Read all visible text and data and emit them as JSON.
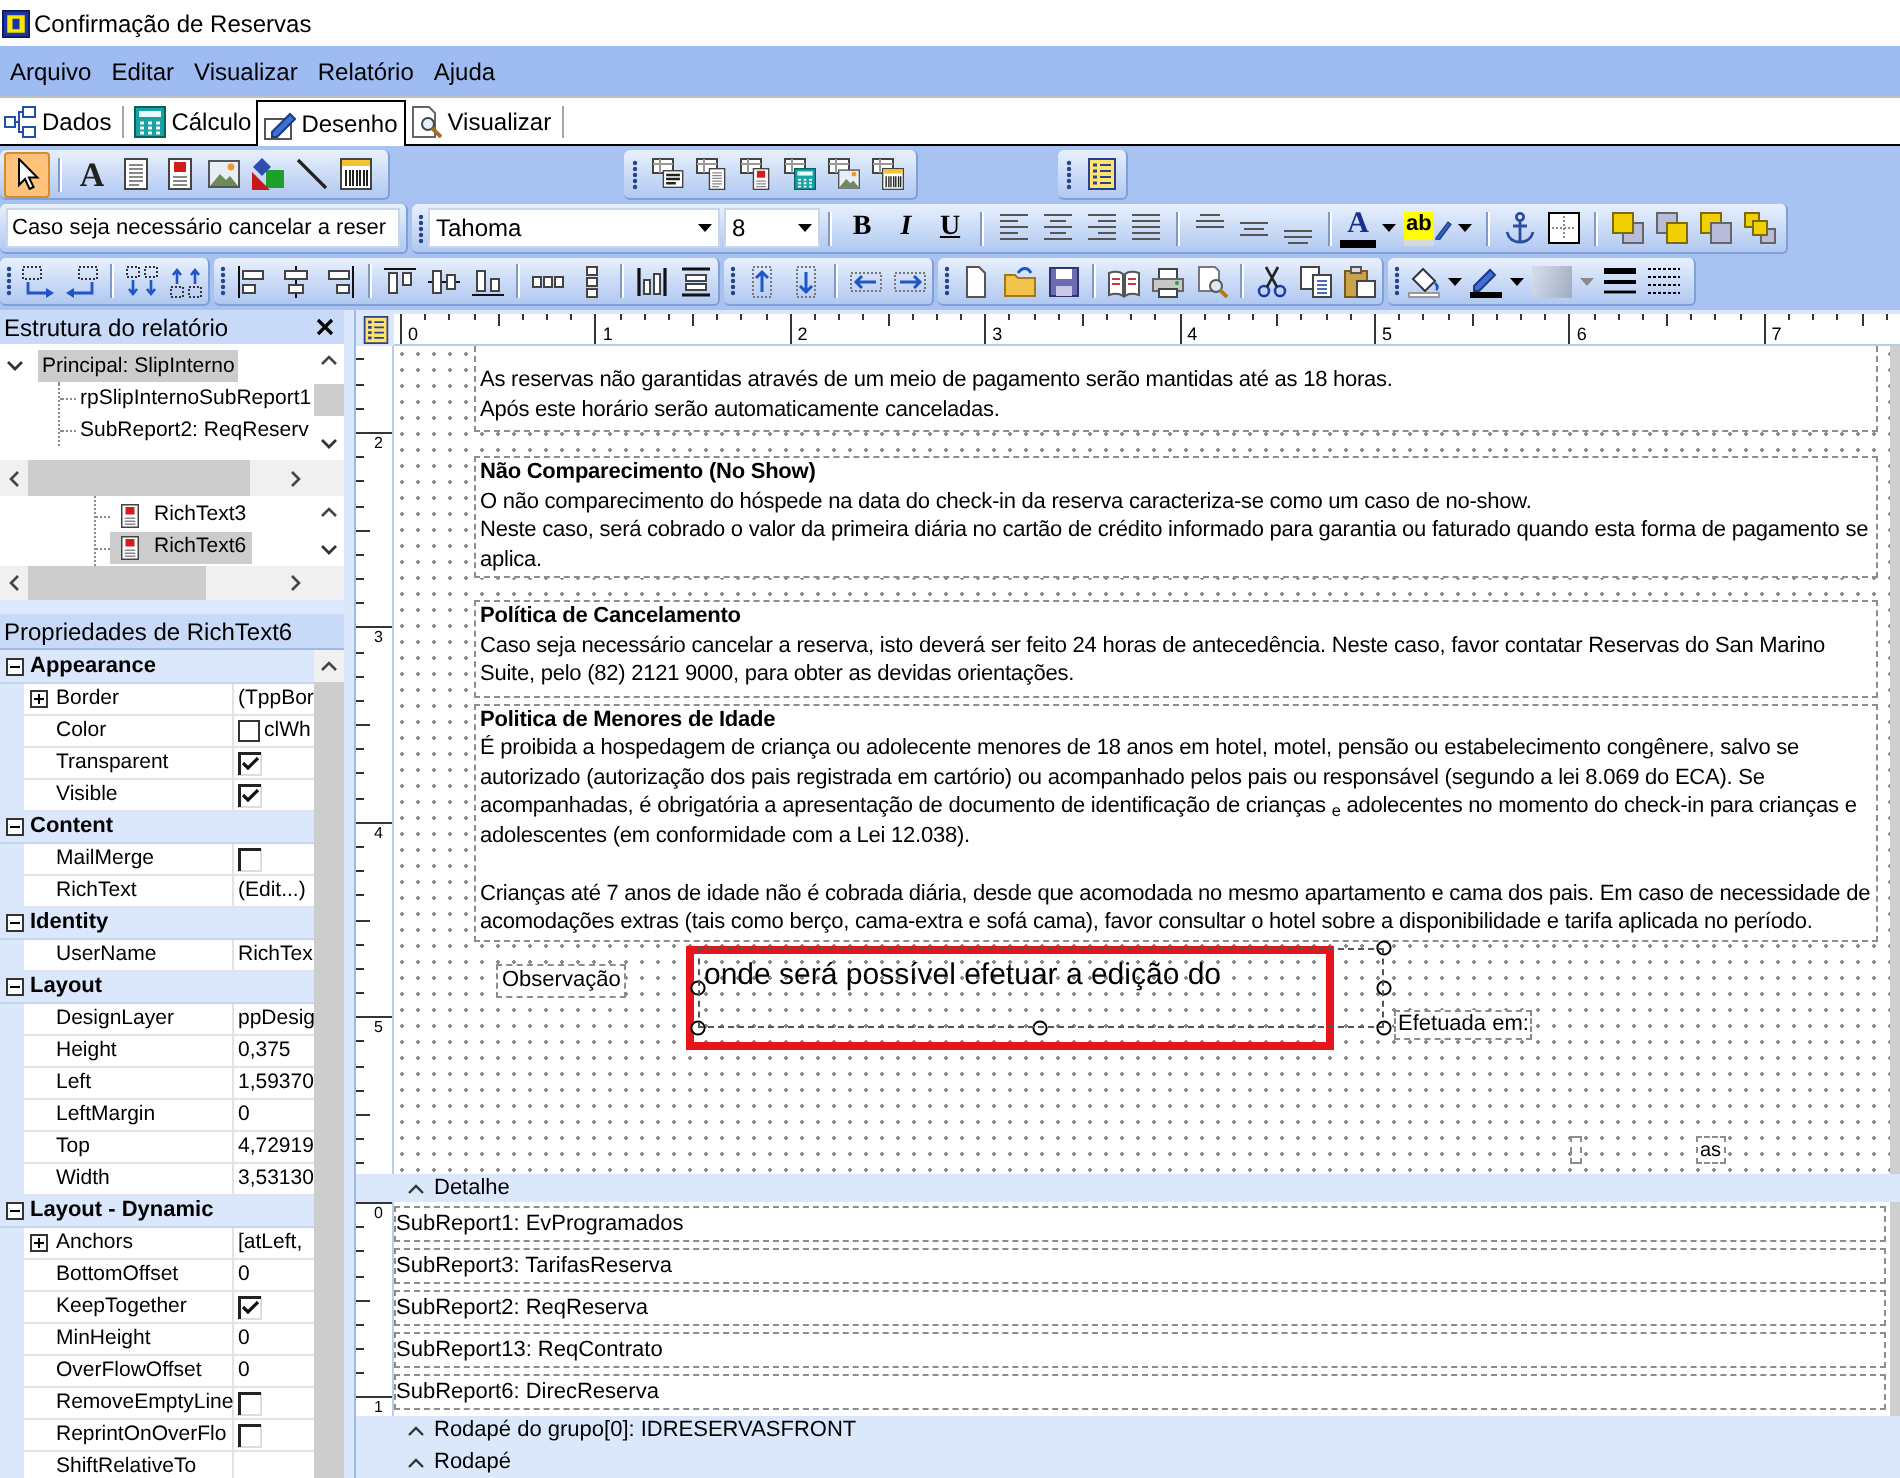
{
  "window": {
    "title": "Confirmação de Reservas"
  },
  "menu": [
    "Arquivo",
    "Editar",
    "Visualizar",
    "Relatório",
    "Ajuda"
  ],
  "tabs": [
    {
      "label": "Dados",
      "selected": false
    },
    {
      "label": "Cálculo",
      "selected": false
    },
    {
      "label": "Desenho",
      "selected": true
    },
    {
      "label": "Visualizar",
      "selected": false
    }
  ],
  "component_tools": [
    {
      "kind": "pointer",
      "selected": true
    },
    {
      "kind": "label",
      "glyph": "A",
      "selected": false
    },
    {
      "kind": "memo",
      "selected": false
    },
    {
      "kind": "richtext",
      "selected": false
    },
    {
      "kind": "image",
      "selected": false
    },
    {
      "kind": "shape",
      "selected": false
    },
    {
      "kind": "line",
      "selected": false
    },
    {
      "kind": "barcode",
      "selected": false
    }
  ],
  "format_bar": {
    "text_field": "Caso seja necessário cancelar a reser",
    "font": "Tahoma",
    "font_size": "8",
    "style_buttons": [
      {
        "kind": "bold",
        "label": "B"
      },
      {
        "kind": "italic",
        "label": "I"
      },
      {
        "kind": "underline",
        "label": "U"
      }
    ],
    "font_color_glyph": "A",
    "highlight_glyph": "ab",
    "shade_disabled": true
  },
  "report_tree": {
    "title": "Estrutura do relatório",
    "items": [
      {
        "label": "Principal: SlipInterno",
        "selected": true,
        "expanded": true,
        "children": [
          {
            "label": "rpSlipInternoSubReport1",
            "selected": false
          },
          {
            "label": "SubReport2: ReqReserv",
            "selected": false
          }
        ]
      }
    ],
    "components": [
      {
        "label": "RichText3",
        "selected": false
      },
      {
        "label": "RichText6",
        "selected": true
      }
    ]
  },
  "properties": {
    "title": "Propriedades de RichText6",
    "categories": [
      {
        "name": "Appearance",
        "expanded": true,
        "rows": [
          {
            "name": "Border",
            "kind": "expand",
            "value": "(TppBor"
          },
          {
            "name": "Color",
            "kind": "color",
            "value": "clWh",
            "color": "#ffffff"
          },
          {
            "name": "Transparent",
            "kind": "check",
            "checked": true
          },
          {
            "name": "Visible",
            "kind": "check",
            "checked": true
          }
        ]
      },
      {
        "name": "Content",
        "expanded": true,
        "rows": [
          {
            "name": "MailMerge",
            "kind": "check",
            "checked": false
          },
          {
            "name": "RichText",
            "kind": "text",
            "value": "(Edit...)"
          }
        ]
      },
      {
        "name": "Identity",
        "expanded": true,
        "rows": [
          {
            "name": "UserName",
            "kind": "text",
            "value": "RichTex"
          }
        ]
      },
      {
        "name": "Layout",
        "expanded": true,
        "rows": [
          {
            "name": "DesignLayer",
            "kind": "text",
            "value": "ppDesig"
          },
          {
            "name": "Height",
            "kind": "text",
            "value": "0,375"
          },
          {
            "name": "Left",
            "kind": "text",
            "value": "1,59370"
          },
          {
            "name": "LeftMargin",
            "kind": "text",
            "value": "0"
          },
          {
            "name": "Top",
            "kind": "text",
            "value": "4,72919"
          },
          {
            "name": "Width",
            "kind": "text",
            "value": "3,53130"
          }
        ]
      },
      {
        "name": "Layout - Dynamic",
        "expanded": true,
        "rows": [
          {
            "name": "Anchors",
            "kind": "expand",
            "value": "[atLeft,"
          },
          {
            "name": "BottomOffset",
            "kind": "text",
            "value": "0"
          },
          {
            "name": "KeepTogether",
            "kind": "check",
            "checked": true
          },
          {
            "name": "MinHeight",
            "kind": "text",
            "value": "0"
          },
          {
            "name": "OverFlowOffset",
            "kind": "text",
            "value": "0"
          },
          {
            "name": "RemoveEmptyLine",
            "kind": "check",
            "checked": false
          },
          {
            "name": "ReprintOnOverFlo",
            "kind": "check",
            "checked": false
          },
          {
            "name": "ShiftRelativeTo",
            "kind": "text"
          }
        ]
      }
    ]
  },
  "designer": {
    "ruler": [
      "0",
      "1",
      "2",
      "3",
      "4",
      "5",
      "6",
      "7"
    ],
    "header_ruler": [
      "2",
      "3",
      "4",
      "5"
    ],
    "text_blocks": [
      {
        "groups": [
          [
            "As reservas não garantidas através de um meio de pagamento serão mantidas até as 18 horas.",
            "Após este horário serão automaticamente canceladas."
          ]
        ]
      },
      {
        "heading": "Não Comparecimento (No Show)",
        "groups": [
          [
            "O não comparecimento do hóspede na data do check-in da reserva caracteriza-se como um caso de no-show.",
            "Neste caso, será cobrado o valor da primeira diária no cartão de crédito informado para garantia ou faturado quando esta forma de pagamento se aplica."
          ]
        ]
      },
      {
        "heading": "Política de Cancelamento",
        "groups": [
          [
            "Caso seja necessário cancelar a reserva, isto deverá ser feito 24 horas de antecedência. Neste caso, favor contatar Reservas do San Marino Suite, pelo (82) 2121 9000, para obter as devidas orientações."
          ]
        ]
      },
      {
        "heading": "Politica de Menores de Idade",
        "groups": [
          [
            "É proibida a hospedagem de criança ou adolecente menores de 18 anos em hotel, motel, pensão ou estabelecimento congênere, salvo se autorizado (autorização dos pais registrada em cartório) ou acompanhado pelos pais ou responsável (segundo a lei 8.069 do ECA). Se acompanhadas, é obrigatória a apresentação de documento de identificação de crianças $_{e}$ adolecentes no momento do check-in para crianças e adolescentes (em conformidade com a Lei 12.038)."
          ],
          [
            "Crianças até 7 anos de idade não é cobrada diária, desde que acomodada no mesmo apartamento e cama dos pais. Em caso de necessidade de acomodações extras (tais como berço, cama-extra e sofá cama), favor consultar o hotel sobre a disponibilidade e tarifa aplicada no período."
          ]
        ]
      }
    ],
    "observation_label": "Observação",
    "rich_text": {
      "text": "onde será possível efetuar a edição do",
      "selected": true
    },
    "date_label": "Efetuada em:",
    "small_label": "as",
    "detail_band": "Detalhe",
    "detail_ruler": [
      "0",
      "1"
    ],
    "subreports": [
      "SubReport1: EvProgramados",
      "SubReport3: TarifasReserva",
      "SubReport2: ReqReserva",
      "SubReport13: ReqContrato",
      "SubReport6: DirecReserva"
    ],
    "footer_bands": [
      "Rodapé do grupo[0]: IDRESERVASFRONT",
      "Rodapé"
    ]
  }
}
